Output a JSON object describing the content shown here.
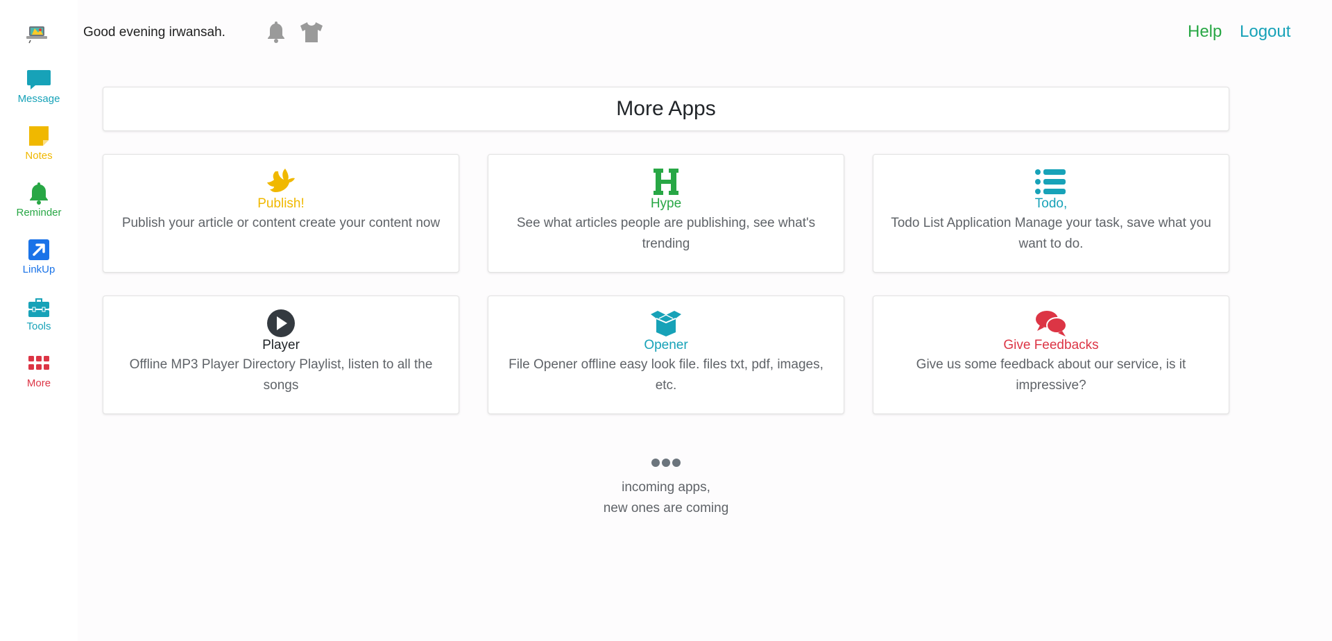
{
  "sidebar": {
    "items": [
      {
        "label": "Message",
        "icon": "message-icon",
        "color": "#17a2b8"
      },
      {
        "label": "Notes",
        "icon": "note-icon",
        "color": "#f0b800"
      },
      {
        "label": "Reminder",
        "icon": "bell-icon",
        "color": "#28a745"
      },
      {
        "label": "LinkUp",
        "icon": "external-link-icon",
        "color": "#1a73e8"
      },
      {
        "label": "Tools",
        "icon": "toolbox-icon",
        "color": "#17a2b8"
      },
      {
        "label": "More",
        "icon": "grid-icon",
        "color": "#dc3545"
      }
    ]
  },
  "header": {
    "greeting": "Good evening irwansah.",
    "help_label": "Help",
    "help_color": "#28a745",
    "logout_label": "Logout",
    "logout_color": "#17a2b8"
  },
  "main": {
    "title": "More Apps",
    "apps": [
      {
        "title": "Publish!",
        "desc": "Publish your article or content create your content now",
        "icon": "dove-icon",
        "color": "#f0b800"
      },
      {
        "title": "Hype",
        "desc": "See what articles people are publishing, see what's trending",
        "icon": "h-icon",
        "color": "#28a745"
      },
      {
        "title": "Todo,",
        "desc": "Todo List Application Manage your task, save what you want to do.",
        "icon": "list-icon",
        "color": "#17a2b8"
      },
      {
        "title": "Player",
        "desc": "Offline MP3 Player Directory Playlist, listen to all the songs",
        "icon": "play-icon",
        "color": "#343a40"
      },
      {
        "title": "Opener",
        "desc": "File Opener offline easy look file. files txt, pdf, images, etc.",
        "icon": "open-box-icon",
        "color": "#17a2b8"
      },
      {
        "title": "Give Feedbacks",
        "desc": "Give us some feedback about our service, is it impressive?",
        "icon": "comments-icon",
        "color": "#dc3545"
      }
    ],
    "footer_line1": "incoming apps,",
    "footer_line2": "new ones are coming"
  }
}
